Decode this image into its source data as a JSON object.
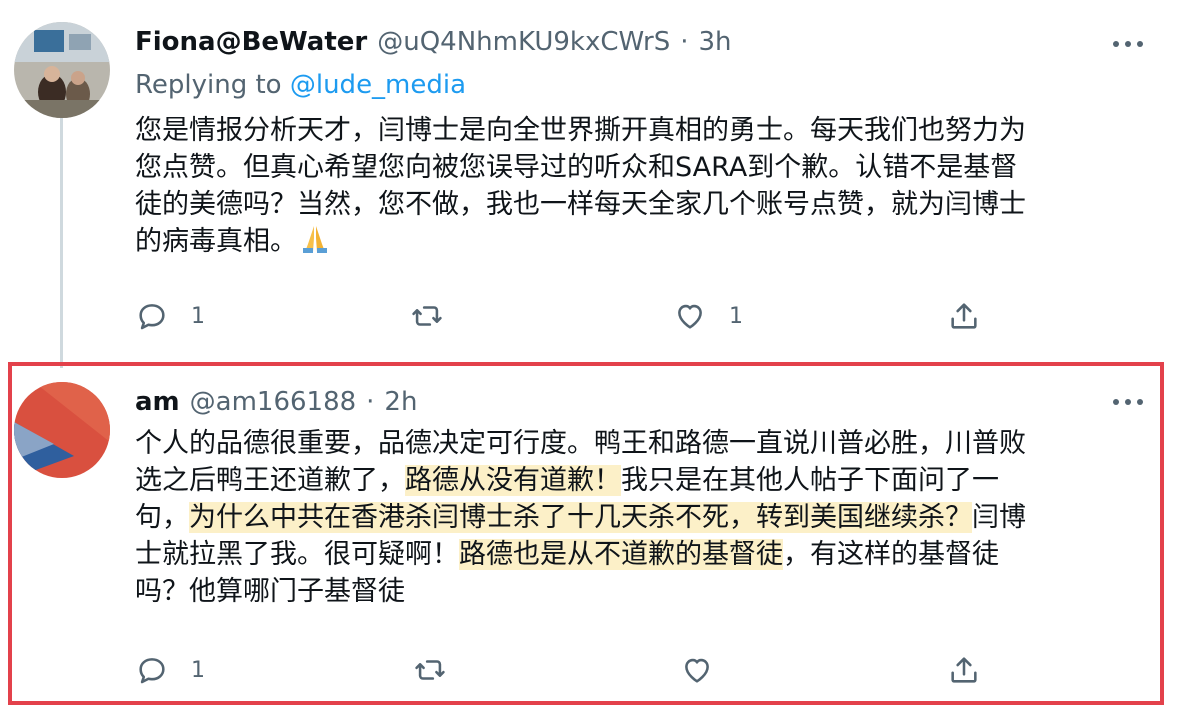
{
  "tweet1": {
    "display_name": "Fiona@BeWater",
    "handle": "@uQ4NhmKU9kxCWrS",
    "separator": "·",
    "time": "3h",
    "replying_prefix": "Replying to ",
    "replying_handle": "@lude_media",
    "lines": [
      "您是情报分析天才，闫博士是向全世界撕开真相的勇士。每天我们也努力为",
      "您点赞。但真心希望您向被您误导过的听众和SARA到个歉。认错不是基督",
      "徒的美德吗？当然，您不做，我也一样每天全家几个账号点赞，就为闫博士",
      "的病毒真相。"
    ],
    "emoji": "folded-hands",
    "reply_count": "1",
    "retweet_count": "",
    "like_count": "1"
  },
  "tweet2": {
    "display_name": "am",
    "handle": "@am166188",
    "separator": "·",
    "time": "2h",
    "line1": "个人的品德很重要，品德决定可行度。鸭王和路德一直说川普必胜，川普败",
    "line2_a": "选之后鸭王还道歉了，",
    "line2_hl": "路德从没有道歉！",
    "line2_b": "我只是在其他人帖子下面问了一",
    "line3_a": "句，",
    "line3_hl": "为什么中共在香港杀闫博士杀了十几天杀不死，转到美国继续杀？",
    "line3_b": "闫博",
    "line4_a": "士就拉黑了我。很可疑啊！",
    "line4_hl": "路德也是从不道歉的基督徒",
    "line4_b": "，有这样的基督徒",
    "line5": "吗？他算哪门子基督徒",
    "reply_count": "1",
    "retweet_count": "",
    "like_count": ""
  },
  "colors": {
    "highlight_frame": "#e3414b",
    "link": "#1d9bf0",
    "muted": "#536471",
    "text_highlight": "#fcf0c8"
  }
}
